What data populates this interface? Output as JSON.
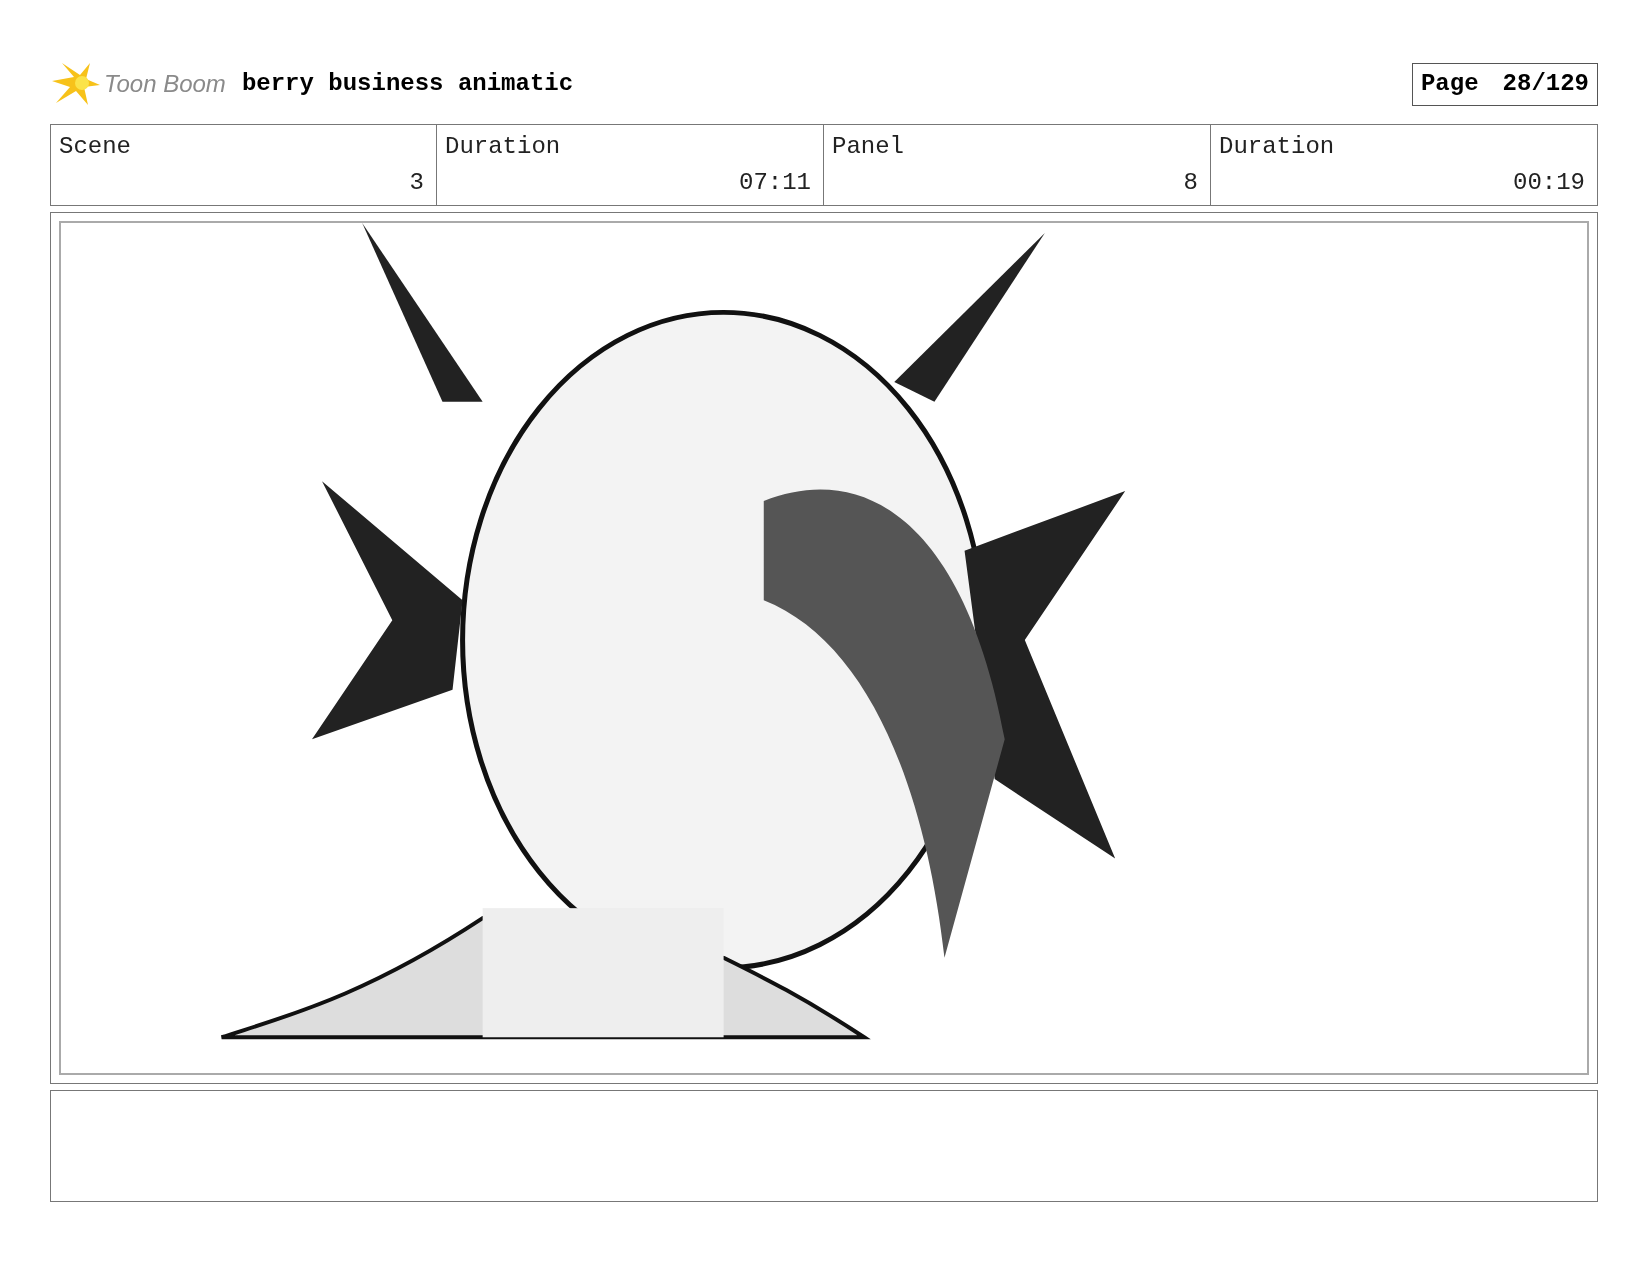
{
  "header": {
    "logo_text": "Toon Boom",
    "title": "berry business animatic",
    "page_label": "Page",
    "page_number": "28/129"
  },
  "fields": [
    {
      "label": "Scene",
      "value": "3"
    },
    {
      "label": "Duration",
      "value": "07:11"
    },
    {
      "label": "Panel",
      "value": "8"
    },
    {
      "label": "Duration",
      "value": "00:19"
    }
  ]
}
